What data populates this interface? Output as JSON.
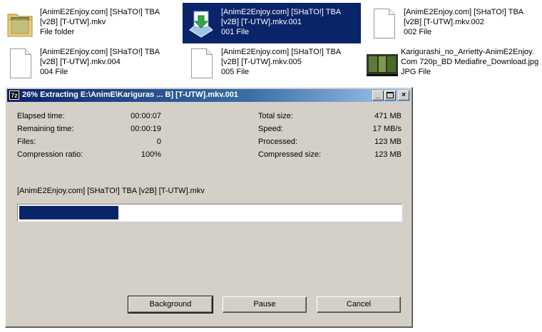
{
  "files": [
    {
      "line1": "[AnimE2Enjoy.com] [SHaTO!] TBA",
      "line2": "[v2B] [T-UTW].mkv",
      "line3": "File folder",
      "icon": "folder-icon"
    },
    {
      "line1": "[AnimE2Enjoy.com] [SHaTO!] TBA",
      "line2": "[v2B] [T-UTW].mkv.001",
      "line3": "001 File",
      "icon": "archive-extract-icon"
    },
    {
      "line1": "[AnimE2Enjoy.com] [SHaTO!] TBA",
      "line2": "[v2B] [T-UTW].mkv.002",
      "line3": "002 File",
      "icon": "document-icon"
    },
    {
      "line1": "[AnimE2Enjoy.com] [SHaTO!] TBA",
      "line2": "[v2B] [T-UTW].mkv.004",
      "line3": "004 File",
      "icon": "document-icon"
    },
    {
      "line1": "[AnimE2Enjoy.com] [SHaTO!] TBA",
      "line2": "[v2B] [T-UTW].mkv.005",
      "line3": "005 File",
      "icon": "document-icon"
    },
    {
      "line1": "Karigurashi_no_Arrietty-AnimE2Enjoy.",
      "line2": "Com 720p_BD Mediafire_Download.jpg",
      "line3": "JPG File",
      "icon": "image-thumbnail-icon"
    }
  ],
  "dialog": {
    "app_icon_text": "7z",
    "title": "26% Extracting E:\\AnimE\\Kariguras ... B] [T-UTW].mkv.001",
    "minimize": "_",
    "close": "×",
    "stats_left": [
      {
        "label": "Elapsed time:",
        "value": "00:00:07"
      },
      {
        "label": "Remaining time:",
        "value": "00:00:19"
      },
      {
        "label": "Files:",
        "value": "0"
      },
      {
        "label": "Compression ratio:",
        "value": "100%"
      }
    ],
    "stats_right": [
      {
        "label": "Total size:",
        "value": "471 MB"
      },
      {
        "label": "Speed:",
        "value": "17 MB/s"
      },
      {
        "label": "Processed:",
        "value": "123 MB"
      },
      {
        "label": "Compressed size:",
        "value": "123 MB"
      }
    ],
    "current_file": "[AnimE2Enjoy.com] [SHaTO!] TBA [v2B] [T-UTW].mkv",
    "progress": 0.26,
    "buttons": {
      "background": "Background",
      "pause": "Pause",
      "cancel": "Cancel"
    }
  },
  "colors": {
    "selection": "#0a246a",
    "dialog_bg": "#d4d0c8",
    "progress_fill": "#0a246a"
  }
}
